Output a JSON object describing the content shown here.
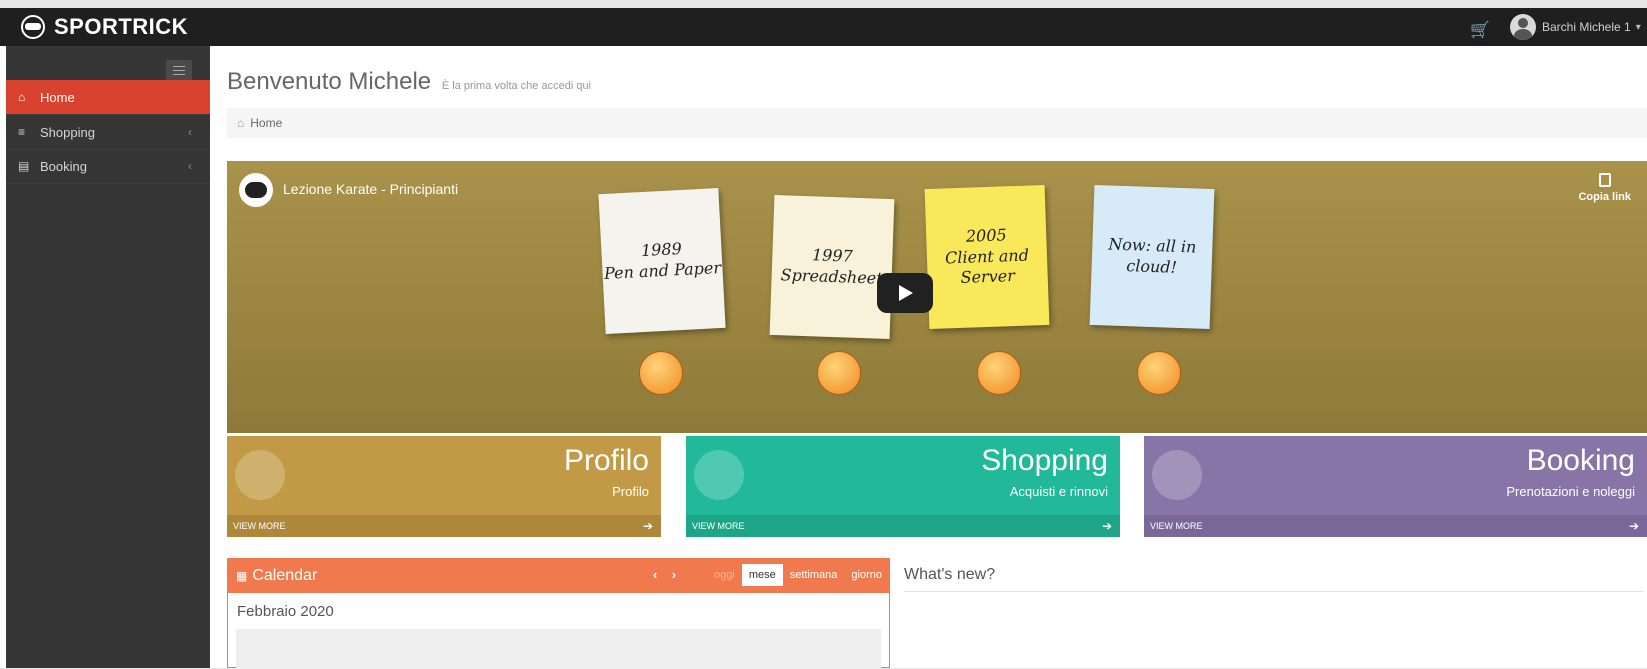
{
  "header": {
    "logo_text": "SPORTRICK",
    "user_name": "Barchi Michele 1"
  },
  "sidebar": {
    "items": [
      {
        "label": "Home",
        "icon": "home-icon"
      },
      {
        "label": "Shopping",
        "icon": "cart-icon"
      },
      {
        "label": "Booking",
        "icon": "book-icon"
      }
    ]
  },
  "main": {
    "title": "Benvenuto Michele",
    "subtitle": "È la prima volta che accedi qui",
    "breadcrumb": "Home"
  },
  "video": {
    "title": "Lezione Karate - Principianti",
    "copy_label": "Copia link",
    "notes": [
      {
        "year": "1989",
        "text": "Pen and Paper"
      },
      {
        "year": "1997",
        "text": "Spreadsheet"
      },
      {
        "year": "2005",
        "text": "Client and Server"
      },
      {
        "year": "",
        "text": "Now: all in cloud!"
      }
    ]
  },
  "tiles": [
    {
      "title": "Profilo",
      "subtitle": "Profilo",
      "more": "VIEW MORE",
      "color": "#c29a45"
    },
    {
      "title": "Shopping",
      "subtitle": "Acquisti e rinnovi",
      "more": "VIEW MORE",
      "color": "#21b99a"
    },
    {
      "title": "Booking",
      "subtitle": "Prenotazioni e noleggi",
      "more": "VIEW MORE",
      "color": "#8775a7"
    }
  ],
  "calendar": {
    "title": "Calendar",
    "today": "oggi",
    "views": [
      "mese",
      "settimana",
      "giorno"
    ],
    "month": "Febbraio 2020"
  },
  "whats_new": {
    "title": "What's new?"
  }
}
